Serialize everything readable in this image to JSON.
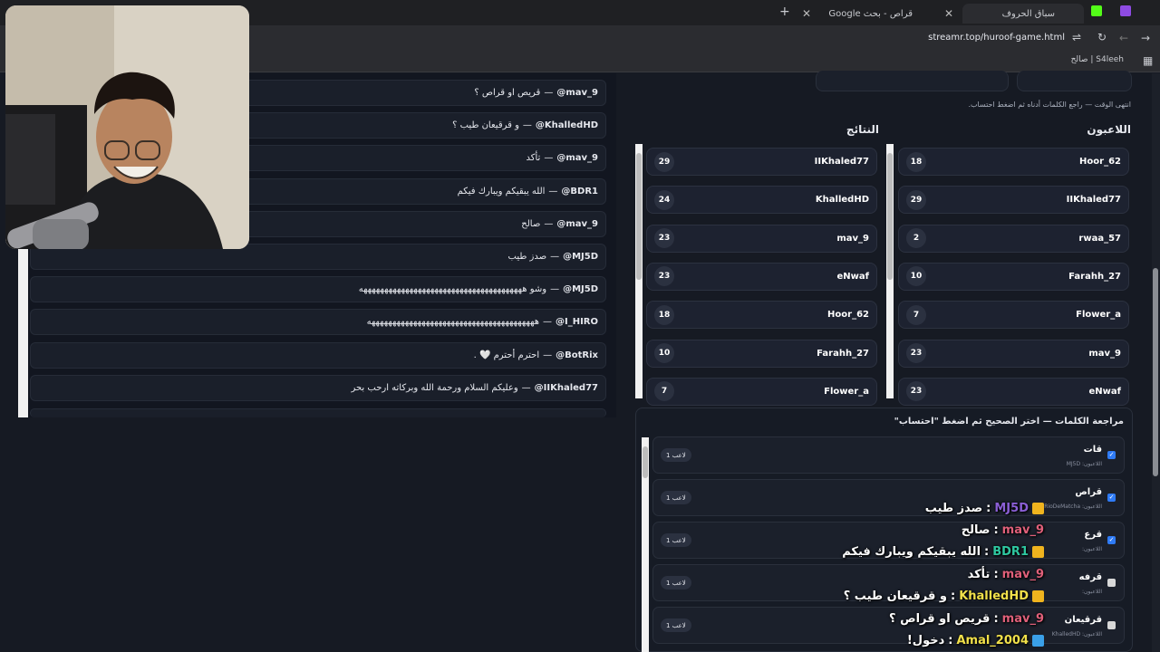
{
  "browser": {
    "tabs": [
      {
        "title": "سباق الحروف",
        "active": true
      },
      {
        "title": "قراص - بحث Google",
        "active": false
      }
    ],
    "new_tab": "+",
    "url": "streamr.top/huroof-game.html",
    "bookmark": "S4leeh | صالح"
  },
  "chat_messages": [
    {
      "user": "mav_9@",
      "text": "قريص او قراص ؟"
    },
    {
      "user": "KhalledHD@",
      "text": "و قرقيعان طيب ؟"
    },
    {
      "user": "mav_9@",
      "text": "تأكد"
    },
    {
      "user": "BDR1@",
      "text": "الله يبقيكم ويبارك فيكم"
    },
    {
      "user": "mav_9@",
      "text": "صالح"
    },
    {
      "user": "MJ5D@",
      "text": "صدز طيب"
    },
    {
      "user": "MJ5D@",
      "text": "وشو هههههههههههههههههههههههههههههههههههههههه"
    },
    {
      "user": "I_HIRO@",
      "text": "ههههههههههههههههههههههههههههههههههههههههه"
    },
    {
      "user": "BotRix@",
      "text": "احترم أحترم 🤍 ."
    },
    {
      "user": "IIKhaled77@",
      "text": "وعليكم السلام ورحمة الله وبركاته ارحب بحر"
    }
  ],
  "separator": "—",
  "timeout_note": "انتهى الوقت — راجع الكلمات أدناه ثم اضغط احتساب.",
  "players": {
    "title": "اللاعبون",
    "rows": [
      {
        "name": "Hoor_62",
        "score": "18"
      },
      {
        "name": "IIKhaled77",
        "score": "29"
      },
      {
        "name": "rwaa_57",
        "score": "2"
      },
      {
        "name": "Farahh_27",
        "score": "10"
      },
      {
        "name": "Flower_a",
        "score": "7"
      },
      {
        "name": "mav_9",
        "score": "23"
      },
      {
        "name": "eNwaf",
        "score": "23"
      }
    ]
  },
  "results": {
    "title": "النتائج",
    "rows": [
      {
        "name": "IIKhaled77",
        "score": "29"
      },
      {
        "name": "KhalledHD",
        "score": "24"
      },
      {
        "name": "mav_9",
        "score": "23"
      },
      {
        "name": "eNwaf",
        "score": "23"
      },
      {
        "name": "Hoor_62",
        "score": "18"
      },
      {
        "name": "Farahh_27",
        "score": "10"
      },
      {
        "name": "Flower_a",
        "score": "7"
      }
    ]
  },
  "review": {
    "title": "مراجعة الكلمات — اختر الصحيح ثم اضغط \"احتساب\"",
    "words": [
      {
        "word": "قات",
        "players": "اللاعبون: MJ5D",
        "count": "1 لاعب",
        "checked": true
      },
      {
        "word": "قراص",
        "players": "اللاعبون: RioDeMatcha",
        "count": "1 لاعب",
        "checked": true
      },
      {
        "word": "قرع",
        "players": "اللاعبون:",
        "count": "1 لاعب",
        "checked": true
      },
      {
        "word": "قرفه",
        "players": "اللاعبون:",
        "count": "1 لاعب",
        "checked": false
      },
      {
        "word": "قرقيعان",
        "players": "اللاعبون: KhalledHD",
        "count": "1 لاعب",
        "checked": false
      }
    ]
  },
  "overlay_chat": [
    {
      "user": "MJ5D",
      "text": "صدز طيب",
      "color": "#8b5fd6"
    },
    {
      "user": "mav_9",
      "text": "صالح",
      "color": "#e0607a"
    },
    {
      "user": "BDR1",
      "text": "الله يبقيكم ويبارك فيكم",
      "color": "#2ec7a0"
    },
    {
      "user": "mav_9",
      "text": "تأكد",
      "color": "#e0607a"
    },
    {
      "user": "KhalledHD",
      "text": "و قرقيعان طيب ؟",
      "color": "#f1e04a"
    },
    {
      "user": "mav_9",
      "text": "قريص او قراص ؟",
      "color": "#e0607a"
    },
    {
      "user": "Amal_2004",
      "text": "دخول!",
      "color": "#f1e04a"
    }
  ],
  "colors": {
    "accent": "#2f7bf6",
    "bg": "#161a23"
  }
}
